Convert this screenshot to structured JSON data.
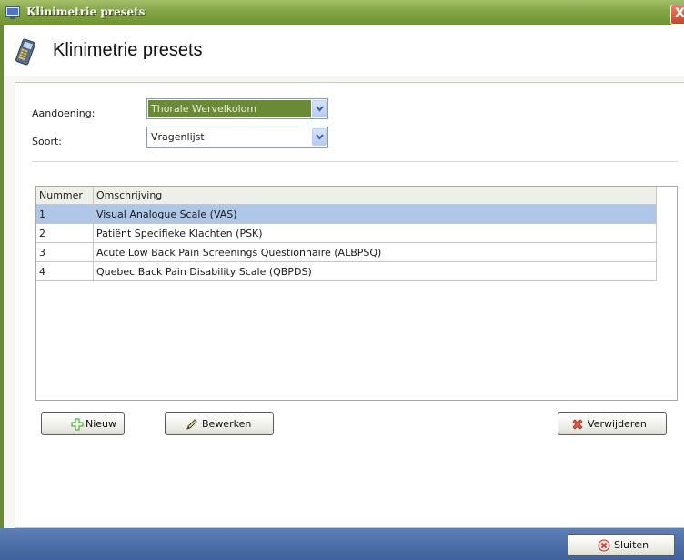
{
  "window": {
    "title": "Klinimetrie presets",
    "close_glyph": "X"
  },
  "header": {
    "title": "Klinimetrie presets",
    "icon": "pda-icon"
  },
  "form": {
    "aandoening_label": "Aandoening:",
    "aandoening_value": "Thorale Wervelkolom",
    "soort_label": "Soort:",
    "soort_value": "Vragenlijst"
  },
  "grid": {
    "columns": [
      "Nummer",
      "Omschrijving"
    ],
    "rows": [
      {
        "nummer": "1",
        "omschrijving": "Visual Analogue Scale (VAS)",
        "selected": true
      },
      {
        "nummer": "2",
        "omschrijving": "Patiënt Specifieke Klachten (PSK)",
        "selected": false
      },
      {
        "nummer": "3",
        "omschrijving": "Acute Low Back Pain Screenings Questionnaire (ALBPSQ)",
        "selected": false
      },
      {
        "nummer": "4",
        "omschrijving": "Quebec Back Pain Disability Scale (QBPDS)",
        "selected": false
      }
    ]
  },
  "buttons": {
    "new_label": "Nieuw",
    "edit_label": "Bewerken",
    "delete_label": "Verwijderen",
    "close_label": "Sluiten"
  },
  "colors": {
    "titlebar": "#83a445",
    "selection_combo": "#6b8a35",
    "selection_row": "#aec6e8",
    "statusbar": "#4a6da6"
  }
}
